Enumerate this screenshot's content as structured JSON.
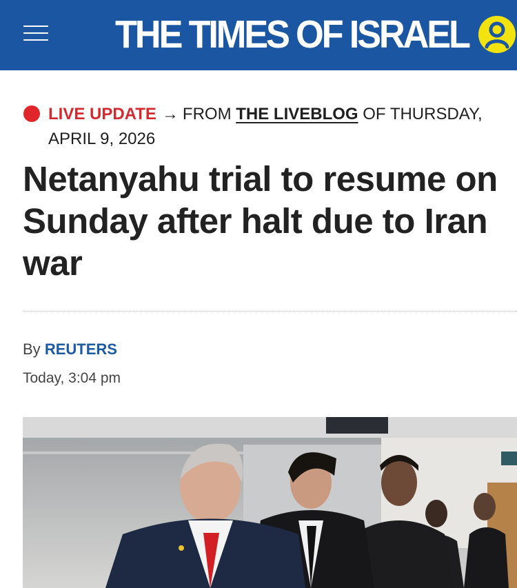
{
  "header": {
    "brand": "THE TIMES OF ISRAEL",
    "menu_icon": "hamburger-menu-icon",
    "account_icon": "user-account-icon",
    "colors": {
      "background": "#1b56a3",
      "account_accent": "#f2e30e"
    }
  },
  "live": {
    "label": "LIVE UPDATE",
    "arrow": "→",
    "from_text": "FROM",
    "liveblog_link": "THE LIVEBLOG",
    "of_text": "OF THURSDAY,",
    "date": "APRIL 9, 2026",
    "colors": {
      "dot": "#e0252b"
    }
  },
  "article": {
    "headline": "Netanyahu trial to resume on Sunday after halt due to Iran war",
    "byline_prefix": "By",
    "author": "REUTERS",
    "timestamp": "Today, 3:04 pm"
  }
}
